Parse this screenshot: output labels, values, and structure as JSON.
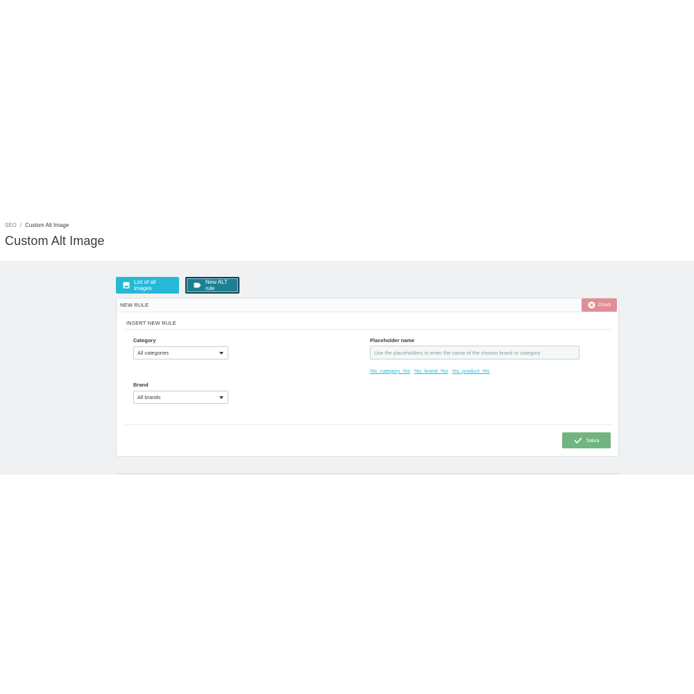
{
  "breadcrumb": {
    "parent": "SEO",
    "separator": "/",
    "current": "Custom Alt Image"
  },
  "page": {
    "title": "Custom Alt Image"
  },
  "toolbar": {
    "list_label": "List of all images",
    "new_rule_label": "New ALT rule"
  },
  "panel": {
    "title": "NEW RULE",
    "close_label": "Chiudi",
    "legend": "INSERT NEW RULE",
    "category": {
      "label": "Category",
      "value": "All categories"
    },
    "brand": {
      "label": "Brand",
      "value": "All brands"
    },
    "placeholder_name": {
      "label": "Placeholder name",
      "placeholder": "Use the placeholders to enter the name of the chosen brand or category",
      "value": ""
    },
    "placeholder_tokens": [
      "%s_category_%s",
      "%s_brand_%s",
      "%s_product_%s"
    ],
    "save_label": "Salva"
  },
  "colors": {
    "primary": "#25b9d7",
    "primary_dark": "#1c7f93",
    "danger": "#e08f95",
    "success": "#70b580"
  },
  "icons": {
    "list": "image-icon",
    "new_rule": "tag-icon",
    "close": "close-circle-icon",
    "save": "check-icon",
    "select": "caret-down-icon"
  }
}
